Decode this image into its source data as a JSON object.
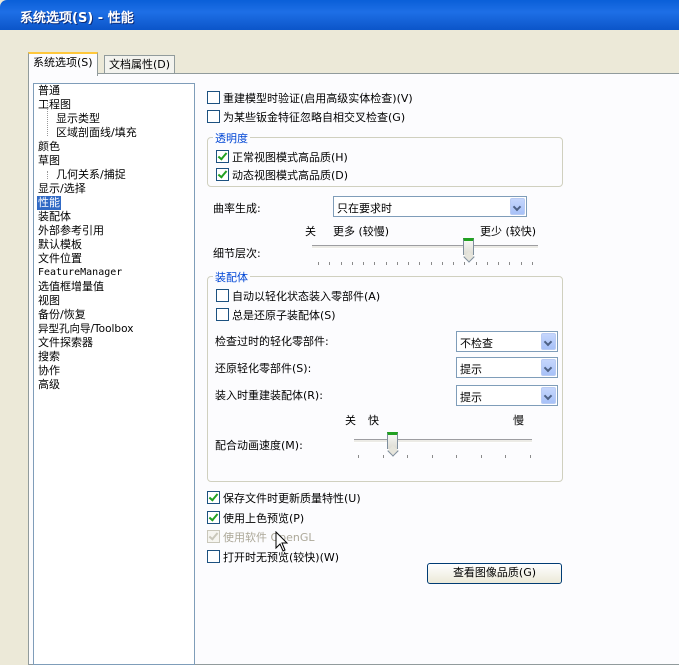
{
  "window": {
    "title": "系统选项(S) - 性能"
  },
  "tabs": [
    {
      "label": "系统选项(S)"
    },
    {
      "label": "文档属性(D)"
    }
  ],
  "tree": {
    "items": [
      "普通",
      "工程图",
      "显示类型",
      "区域剖面线/填充",
      "颜色",
      "草图",
      "几何关系/捕捉",
      "显示/选择",
      "性能",
      "装配体",
      "外部参考引用",
      "默认模板",
      "文件位置",
      "FeatureManager",
      "选值框增量值",
      "视图",
      "备份/恢复",
      "异型孔向导/Toolbox",
      "文件探索器",
      "搜索",
      "协作",
      "高级"
    ]
  },
  "options": {
    "verify_rebuild": "重建模型时验证(启用高级实体检查)(V)",
    "ignore_self_intersect": "为某些钣金特征忽略自相交叉检查(G)"
  },
  "transparency": {
    "title": "透明度",
    "normal_hq": "正常视图模式高品质(H)",
    "dynamic_hq": "动态视图模式高品质(D)"
  },
  "curvature": {
    "label": "曲率生成:",
    "value": "只在要求时"
  },
  "detail": {
    "label": "细节层次:",
    "left": "关",
    "more": "更多 (较慢)",
    "less": "更少 (较快)",
    "level": 0.7
  },
  "assembly": {
    "title": "装配体",
    "auto_lightweight": "自动以轻化状态装入零部件(A)",
    "always_resolve": "总是还原子装配体(S)",
    "check_outdated": {
      "label": "检查过时的轻化零部件:",
      "value": "不检查"
    },
    "resolve_lightweight": {
      "label": "还原轻化零部件(S):",
      "value": "提示"
    },
    "rebuild_on_load": {
      "label": "装入时重建装配体(R):",
      "value": "提示"
    },
    "anim_off": "关",
    "anim_fast": "快",
    "anim_slow": "慢",
    "anim_label": "配合动画速度(M):",
    "anim_level": 0.2
  },
  "bottom": {
    "save_quality": "保存文件时更新质量特性(U)",
    "shaded_preview": "使用上色预览(P)",
    "software_opengl": "使用软件 OpenGL",
    "no_preview": "打开时无预览(较快)(W)"
  },
  "image_quality_button": "查看图像品质(G)"
}
